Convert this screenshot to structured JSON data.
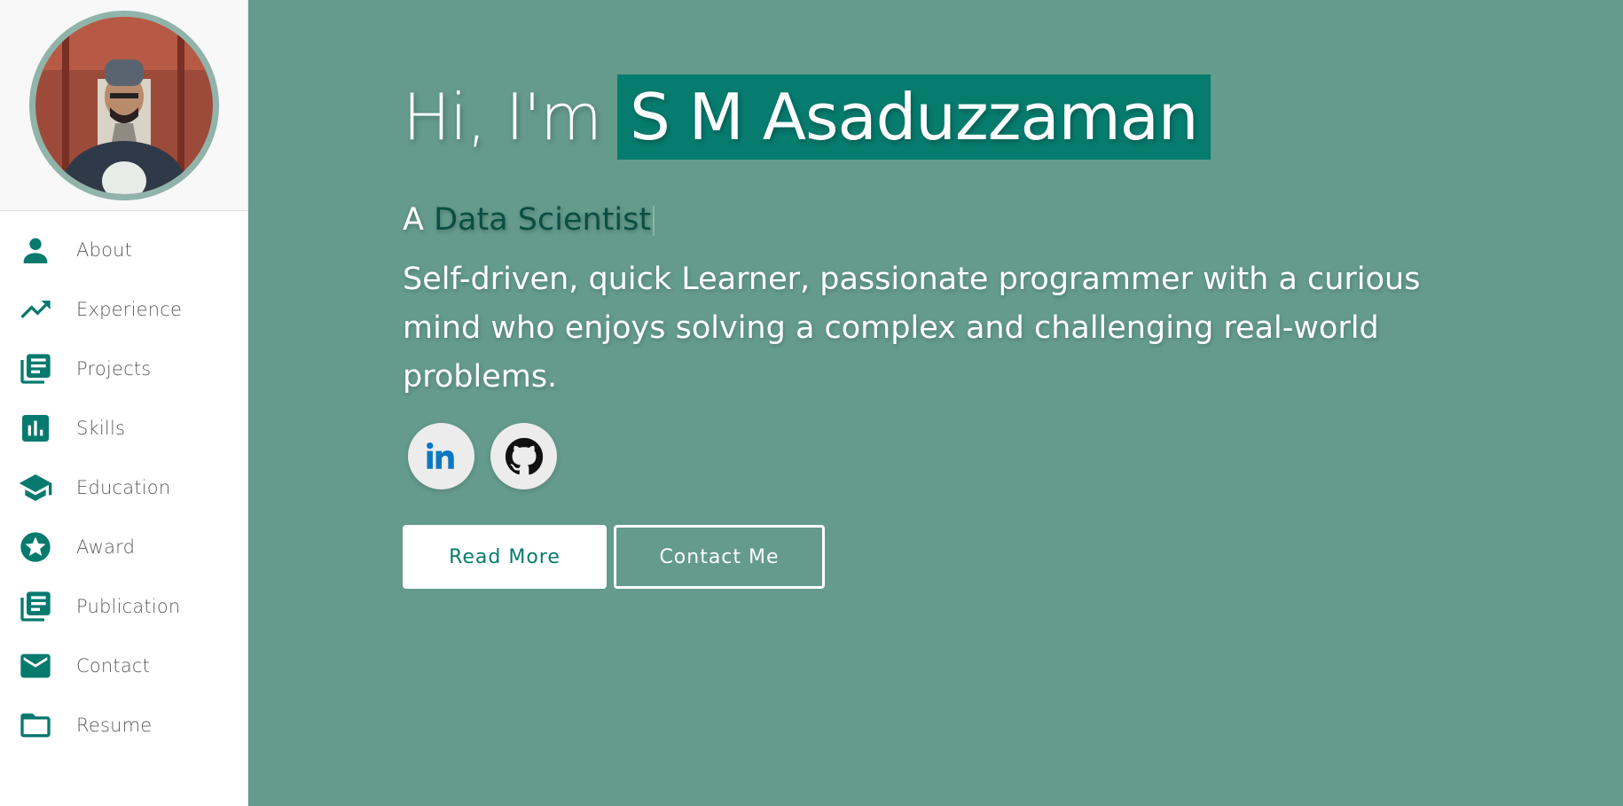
{
  "profile": {
    "avatar_alt": "Profile photo"
  },
  "sidebar": {
    "items": [
      {
        "label": "About",
        "icon": "person-icon"
      },
      {
        "label": "Experience",
        "icon": "trending-up-icon"
      },
      {
        "label": "Projects",
        "icon": "library-books-icon"
      },
      {
        "label": "Skills",
        "icon": "bar-chart-icon"
      },
      {
        "label": "Education",
        "icon": "graduation-cap-icon"
      },
      {
        "label": "Award",
        "icon": "star-icon"
      },
      {
        "label": "Publication",
        "icon": "library-books-icon"
      },
      {
        "label": "Contact",
        "icon": "email-icon"
      },
      {
        "label": "Resume",
        "icon": "folder-icon"
      }
    ]
  },
  "hero": {
    "greeting": "Hi, I'm",
    "name": "S M Asaduzzaman",
    "role_prefix": "A",
    "role": "Data Scientist",
    "bio": "Self-driven, quick Learner, passionate programmer with a curious mind who enjoys solving a complex and challenging real-world problems."
  },
  "socials": [
    {
      "name": "LinkedIn",
      "icon": "linkedin-icon"
    },
    {
      "name": "GitHub",
      "icon": "github-icon"
    }
  ],
  "buttons": {
    "read_more": "Read More",
    "contact_me": "Contact Me"
  },
  "colors": {
    "accent": "#077a6e",
    "background": "#649b8c",
    "name_highlight": "#067c6e",
    "role_text": "#0b4e43"
  }
}
